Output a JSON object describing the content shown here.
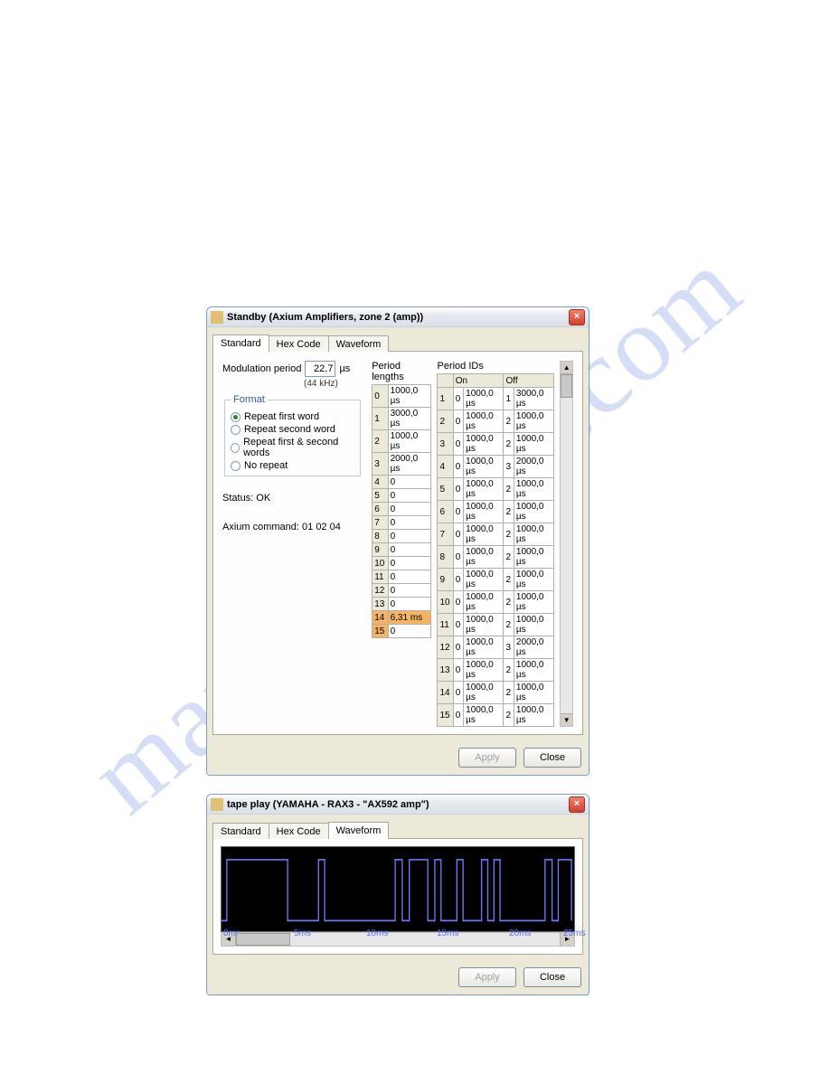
{
  "dialog1": {
    "title": "Standby (Axium Amplifiers, zone 2 (amp))",
    "tabs": {
      "standard": "Standard",
      "hex": "Hex Code",
      "wave": "Waveform"
    },
    "modulation_label": "Modulation period",
    "modulation_value": "22,7",
    "modulation_unit": "µs",
    "modulation_sub": "(44 kHz)",
    "format_legend": "Format",
    "format_options": {
      "rfw": "Repeat first word",
      "rsw": "Repeat second word",
      "rfsw": "Repeat first & second words",
      "nr": "No repeat"
    },
    "status_label": "Status: OK",
    "command_label": "Axium command: 01 02 04",
    "period_lengths_hdr": "Period lengths",
    "period_ids_hdr": "Period IDs",
    "on_hdr": "On",
    "off_hdr": "Off",
    "period_lengths": [
      {
        "i": 0,
        "v": "1000,0 µs"
      },
      {
        "i": 1,
        "v": "3000,0 µs"
      },
      {
        "i": 2,
        "v": "1000,0 µs"
      },
      {
        "i": 3,
        "v": "2000,0 µs"
      },
      {
        "i": 4,
        "v": "0"
      },
      {
        "i": 5,
        "v": "0"
      },
      {
        "i": 6,
        "v": "0"
      },
      {
        "i": 7,
        "v": "0"
      },
      {
        "i": 8,
        "v": "0"
      },
      {
        "i": 9,
        "v": "0"
      },
      {
        "i": 10,
        "v": "0"
      },
      {
        "i": 11,
        "v": "0"
      },
      {
        "i": 12,
        "v": "0"
      },
      {
        "i": 13,
        "v": "0"
      },
      {
        "i": 14,
        "v": "6,31 ms"
      },
      {
        "i": 15,
        "v": "0"
      }
    ],
    "period_ids": [
      {
        "i": 1,
        "on_id": 0,
        "on_v": "1000,0 µs",
        "off_id": 1,
        "off_v": "3000,0 µs"
      },
      {
        "i": 2,
        "on_id": 0,
        "on_v": "1000,0 µs",
        "off_id": 2,
        "off_v": "1000,0 µs"
      },
      {
        "i": 3,
        "on_id": 0,
        "on_v": "1000,0 µs",
        "off_id": 2,
        "off_v": "1000,0 µs"
      },
      {
        "i": 4,
        "on_id": 0,
        "on_v": "1000,0 µs",
        "off_id": 3,
        "off_v": "2000,0 µs"
      },
      {
        "i": 5,
        "on_id": 0,
        "on_v": "1000,0 µs",
        "off_id": 2,
        "off_v": "1000,0 µs"
      },
      {
        "i": 6,
        "on_id": 0,
        "on_v": "1000,0 µs",
        "off_id": 2,
        "off_v": "1000,0 µs"
      },
      {
        "i": 7,
        "on_id": 0,
        "on_v": "1000,0 µs",
        "off_id": 2,
        "off_v": "1000,0 µs"
      },
      {
        "i": 8,
        "on_id": 0,
        "on_v": "1000,0 µs",
        "off_id": 2,
        "off_v": "1000,0 µs"
      },
      {
        "i": 9,
        "on_id": 0,
        "on_v": "1000,0 µs",
        "off_id": 2,
        "off_v": "1000,0 µs"
      },
      {
        "i": 10,
        "on_id": 0,
        "on_v": "1000,0 µs",
        "off_id": 2,
        "off_v": "1000,0 µs"
      },
      {
        "i": 11,
        "on_id": 0,
        "on_v": "1000,0 µs",
        "off_id": 2,
        "off_v": "1000,0 µs"
      },
      {
        "i": 12,
        "on_id": 0,
        "on_v": "1000,0 µs",
        "off_id": 3,
        "off_v": "2000,0 µs"
      },
      {
        "i": 13,
        "on_id": 0,
        "on_v": "1000,0 µs",
        "off_id": 2,
        "off_v": "1000,0 µs"
      },
      {
        "i": 14,
        "on_id": 0,
        "on_v": "1000,0 µs",
        "off_id": 2,
        "off_v": "1000,0 µs"
      },
      {
        "i": 15,
        "on_id": 0,
        "on_v": "1000,0 µs",
        "off_id": 2,
        "off_v": "1000,0 µs"
      }
    ],
    "apply": "Apply",
    "close": "Close"
  },
  "dialog2": {
    "title": "tape play (YAMAHA - RAX3  - \"AX592 amp\")",
    "tabs": {
      "standard": "Standard",
      "hex": "Hex Code",
      "wave": "Waveform"
    },
    "ticks": [
      "0ms",
      "5ms",
      "10ms",
      "15ms",
      "20ms",
      "25ms"
    ],
    "apply": "Apply",
    "close": "Close"
  }
}
